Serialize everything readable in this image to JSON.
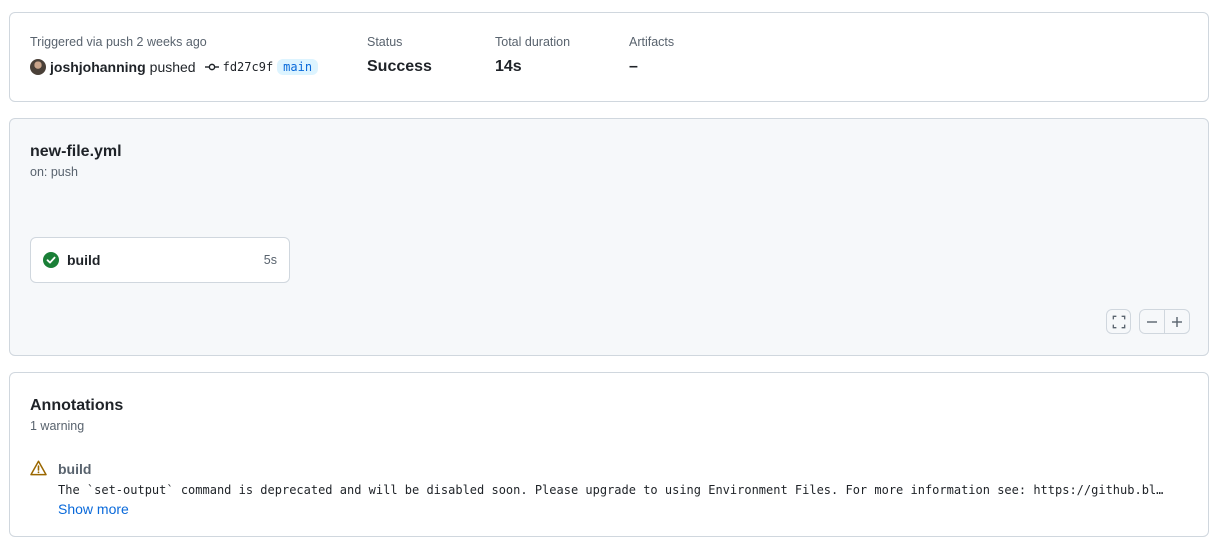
{
  "summary": {
    "trigger_text": "Triggered via push 2 weeks ago",
    "actor": "joshjohanning",
    "action": "pushed",
    "commit_sha": "fd27c9f",
    "branch": "main",
    "status_label": "Status",
    "status_value": "Success",
    "duration_label": "Total duration",
    "duration_value": "14s",
    "artifacts_label": "Artifacts",
    "artifacts_value": "–"
  },
  "workflow": {
    "file": "new-file.yml",
    "trigger": "on: push",
    "jobs": [
      {
        "name": "build",
        "duration": "5s",
        "status": "success",
        "icon": "check-circle-fill-icon"
      }
    ],
    "controls": [
      "fullscreen-icon",
      "zoom-out-icon",
      "zoom-in-icon"
    ]
  },
  "annotations": {
    "title": "Annotations",
    "count": "1 warning",
    "items": [
      {
        "icon": "alert-icon",
        "job": "build",
        "message": "The `set-output` command is deprecated and will be disabled soon. Please upgrade to using Environment Files. For more information see: https://github.bl…"
      }
    ],
    "show_more": "Show more"
  },
  "colors": {
    "success": "#1a7f37",
    "warning": "#9a6700",
    "link": "#0969da",
    "border": "#d0d7de",
    "muted": "#59636e"
  }
}
